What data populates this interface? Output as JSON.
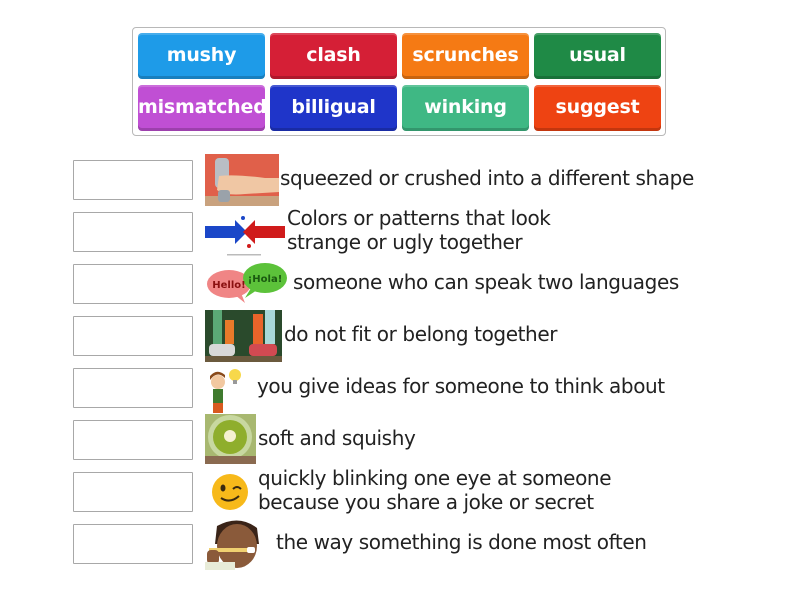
{
  "word_bank": [
    {
      "label": "mushy",
      "color": "#1e9be8"
    },
    {
      "label": "clash",
      "color": "#d51f36"
    },
    {
      "label": "scrunches",
      "color": "#f57a14"
    },
    {
      "label": "usual",
      "color": "#1f8a46"
    },
    {
      "label": "mismatched",
      "color": "#c04fd4"
    },
    {
      "label": "billigual",
      "color": "#1f35c9"
    },
    {
      "label": "winking",
      "color": "#3fb884"
    },
    {
      "label": "suggest",
      "color": "#ee4312"
    }
  ],
  "rows": [
    {
      "answer": "",
      "image": "hand-squeezing-can-image",
      "definition_lines": [
        "squeezed or crushed into a different shape"
      ]
    },
    {
      "answer": "",
      "image": "colliding-color-arrows-image",
      "definition_lines": [
        "Colors or patterns that look",
        "strange or ugly together"
      ]
    },
    {
      "answer": "",
      "image": "hello-speech-bubbles-image",
      "definition_lines": [
        "someone who can speak two languages"
      ]
    },
    {
      "answer": "",
      "image": "mismatched-socks-image",
      "definition_lines": [
        "do not fit or belong together"
      ]
    },
    {
      "answer": "",
      "image": "girl-with-lightbulb-image",
      "definition_lines": [
        "you give ideas for someone to think about"
      ]
    },
    {
      "answer": "",
      "image": "mashed-food-bowl-image",
      "definition_lines": [
        "soft and squishy"
      ]
    },
    {
      "answer": "",
      "image": "winking-emoji-image",
      "definition_lines": [
        "quickly blinking one eye at someone",
        "because you share a joke or secret"
      ]
    },
    {
      "answer": "",
      "image": "child-brushing-teeth-image",
      "definition_lines": [
        "the way something is done most often"
      ]
    }
  ]
}
